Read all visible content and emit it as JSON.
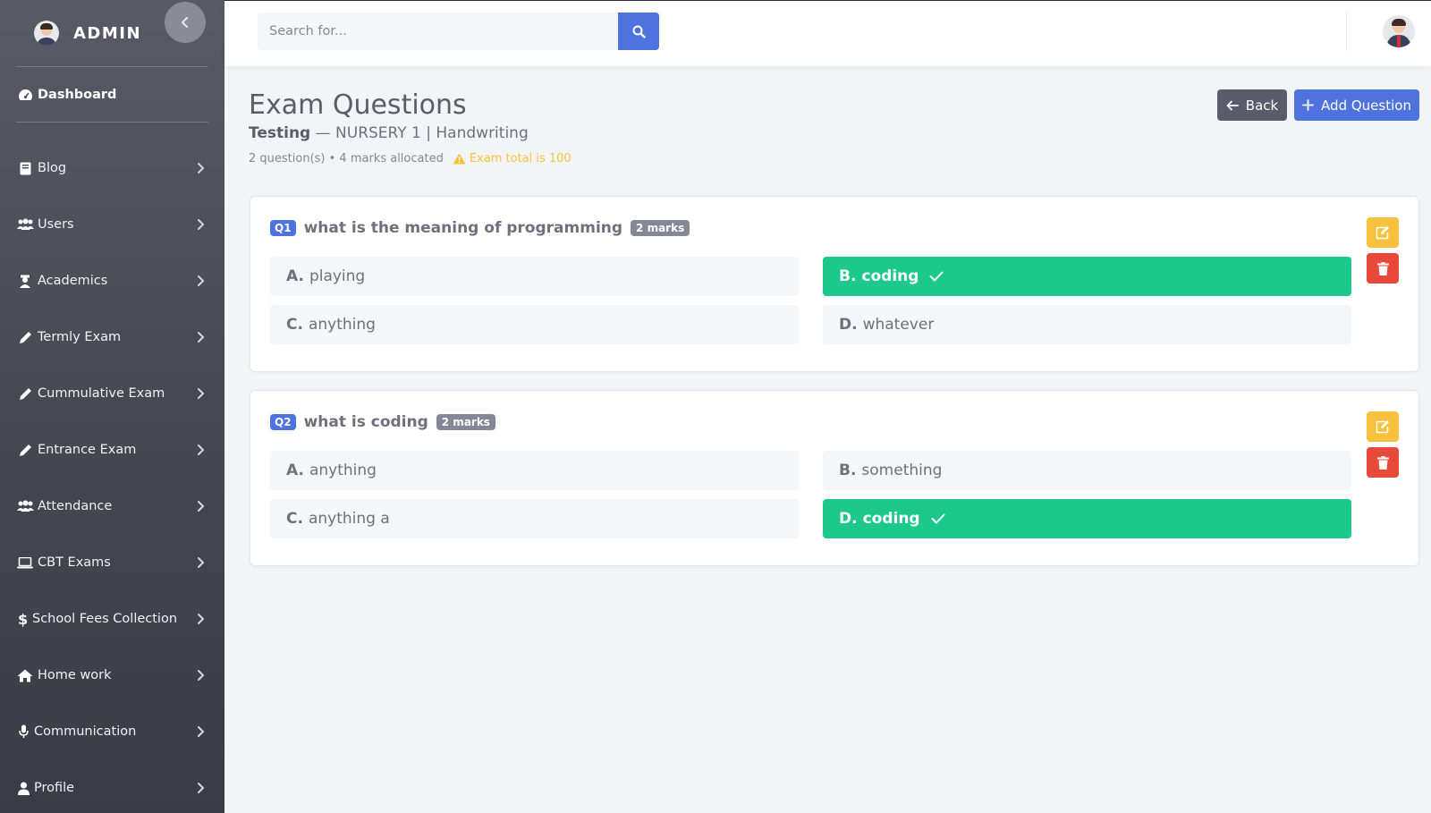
{
  "sidebar": {
    "brand": "ADMIN",
    "dashboard": "Dashboard",
    "items": [
      {
        "label": "Blog",
        "icon": "book-icon"
      },
      {
        "label": "Users",
        "icon": "users-icon"
      },
      {
        "label": "Academics",
        "icon": "graduate-icon"
      },
      {
        "label": "Termly Exam",
        "icon": "pencil-icon"
      },
      {
        "label": "Cummulative Exam",
        "icon": "pencil-icon"
      },
      {
        "label": "Entrance Exam",
        "icon": "pencil-icon"
      },
      {
        "label": "Attendance",
        "icon": "users-icon"
      },
      {
        "label": "CBT Exams",
        "icon": "laptop-icon"
      },
      {
        "label": "School Fees Collection",
        "icon": "dollar-icon"
      },
      {
        "label": "Home work",
        "icon": "home-icon"
      },
      {
        "label": "Communication",
        "icon": "microphone-icon"
      },
      {
        "label": "Profile",
        "icon": "user-icon"
      }
    ]
  },
  "topbar": {
    "search_placeholder": "Search for..."
  },
  "page": {
    "title": "Exam Questions",
    "exam_name": "Testing",
    "exam_detail": "— NURSERY 1 | Handwriting",
    "meta": "2 question(s) • 4 marks allocated",
    "warning": "Exam total is 100",
    "back_label": "Back",
    "add_label": "Add Question"
  },
  "questions": [
    {
      "number": "Q1",
      "text": "what is the meaning of programming",
      "marks": "2 marks",
      "options": [
        {
          "letter": "A.",
          "text": "playing",
          "correct": false
        },
        {
          "letter": "B.",
          "text": "coding",
          "correct": true
        },
        {
          "letter": "C.",
          "text": "anything",
          "correct": false
        },
        {
          "letter": "D.",
          "text": "whatever",
          "correct": false
        }
      ]
    },
    {
      "number": "Q2",
      "text": "what is coding",
      "marks": "2 marks",
      "options": [
        {
          "letter": "A.",
          "text": "anything",
          "correct": false
        },
        {
          "letter": "B.",
          "text": "something",
          "correct": false
        },
        {
          "letter": "C.",
          "text": "anything a",
          "correct": false
        },
        {
          "letter": "D.",
          "text": "coding",
          "correct": true
        }
      ]
    }
  ],
  "colors": {
    "primary": "#4e73df",
    "success": "#1cc88a",
    "warning": "#f6c23e",
    "danger": "#e74a3b",
    "secondary": "#5a5c69"
  }
}
